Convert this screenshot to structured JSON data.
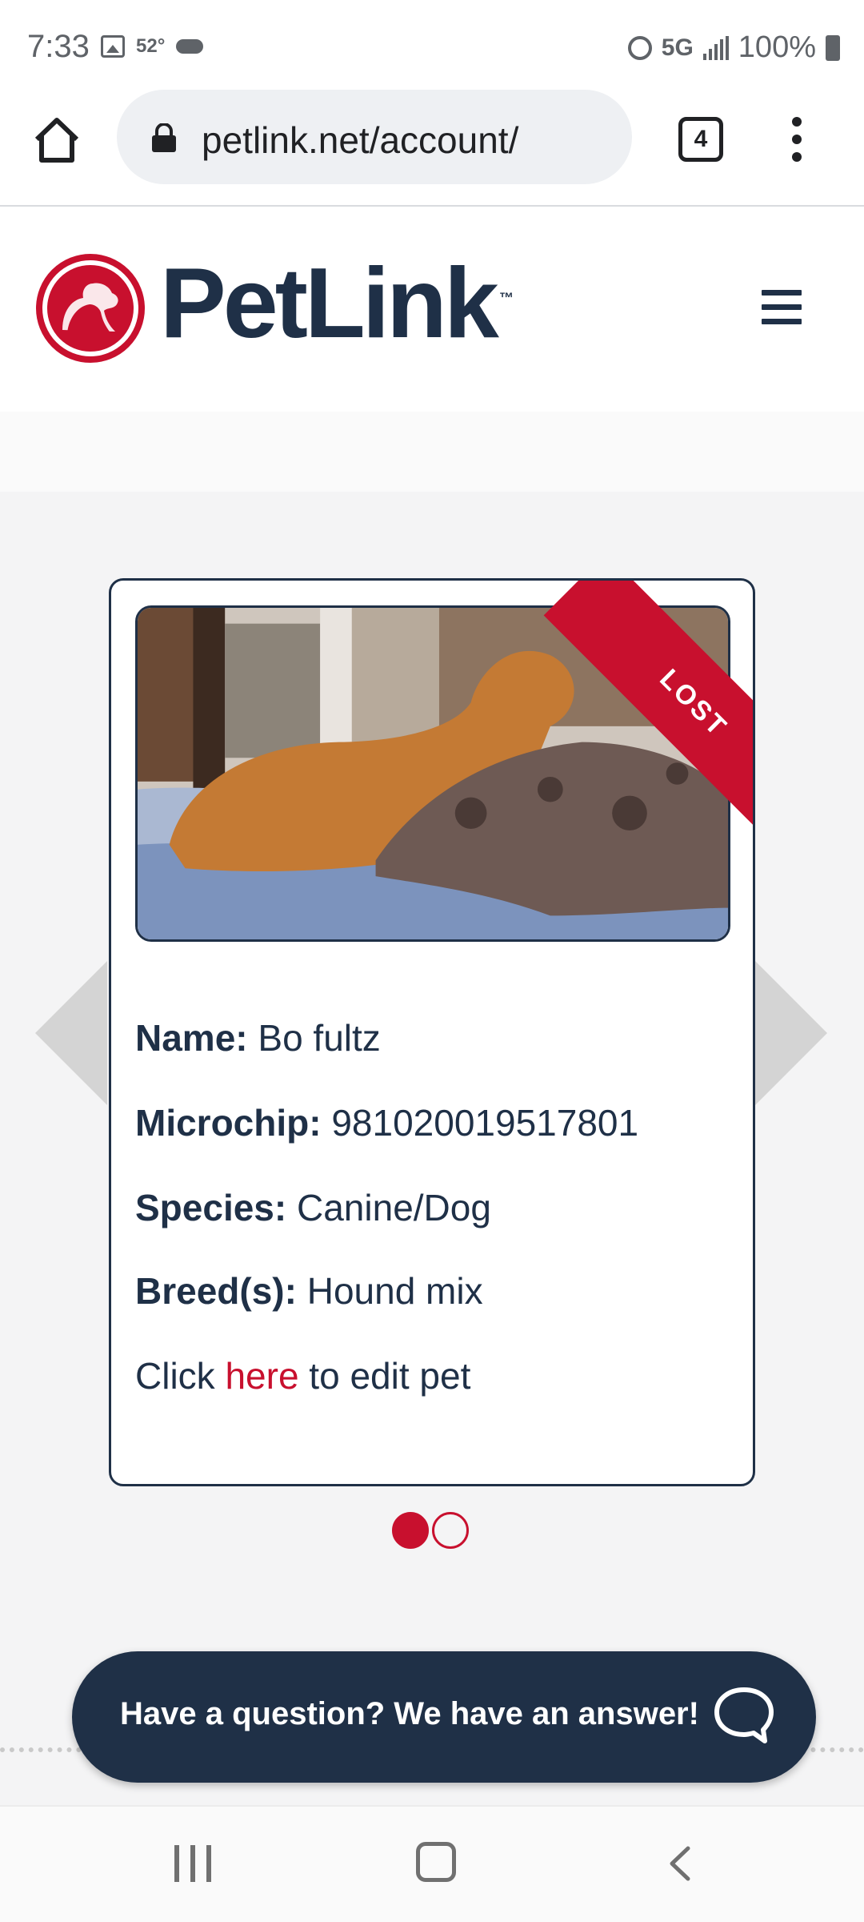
{
  "status_bar": {
    "time": "7:33",
    "temperature": "52°",
    "network": "5G",
    "battery": "100%",
    "icons": [
      "image-icon",
      "cloud-icon",
      "alarm-icon",
      "signal-icon",
      "battery-icon"
    ]
  },
  "browser": {
    "url": "petlink.net/account/",
    "tab_count": "4",
    "icons": [
      "home-icon",
      "lock-icon",
      "tabs-icon",
      "more-menu-icon"
    ]
  },
  "header": {
    "logo_text": "PetLink",
    "logo_tm": "™",
    "icons": [
      "petlink-logo-icon",
      "hamburger-menu-icon"
    ]
  },
  "pet_card": {
    "status_ribbon": "LOST",
    "name_label": "Name:",
    "name_value": "Bo fultz",
    "microchip_label": "Microchip:",
    "microchip_value": "981020019517801",
    "species_label": "Species:",
    "species_value": "Canine/Dog",
    "breed_label": "Breed(s):",
    "breed_value": "Hound mix",
    "edit_prefix": "Click ",
    "edit_link": "here",
    "edit_suffix": " to edit pet"
  },
  "carousel": {
    "total_slides": 2,
    "active_slide": 1
  },
  "chat": {
    "label": "Have a question? We have an answer!"
  },
  "colors": {
    "brand_navy": "#1f3047",
    "brand_red": "#c8102e",
    "page_gray": "#f4f4f5"
  }
}
